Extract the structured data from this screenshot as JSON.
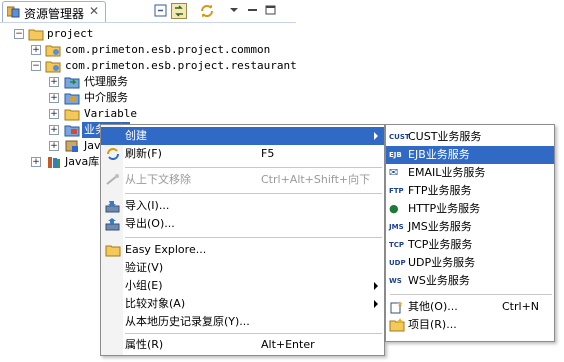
{
  "view": {
    "tab_title": "资源管理器",
    "tab_close": "✕"
  },
  "tree": {
    "items": [
      {
        "label": "project",
        "expander": "−"
      },
      {
        "label": "com.primeton.esb.project.common",
        "expander": "+"
      },
      {
        "label": "com.primeton.esb.project.restaurant",
        "expander": "−"
      },
      {
        "label": "代理服务",
        "expander": "+"
      },
      {
        "label": "中介服务",
        "expander": "+"
      },
      {
        "label": "Variable",
        "expander": "+"
      },
      {
        "label": "业务服务",
        "expander": "+"
      },
      {
        "label": "Java",
        "expander": "+"
      },
      {
        "label": "Java库",
        "expander": "+"
      }
    ]
  },
  "context_menu": {
    "items": [
      {
        "label": "创建",
        "shortcut": "",
        "submenu": true,
        "icon": "none"
      },
      {
        "label": "刷新(F)",
        "shortcut": "F5",
        "icon": "refresh-icon"
      },
      {
        "label": "从上下文移除",
        "shortcut": "Ctrl+Alt+Shift+向下",
        "disabled": true,
        "icon": "remove-context-icon"
      },
      {
        "label": "导入(I)...",
        "shortcut": "",
        "icon": "import-icon"
      },
      {
        "label": "导出(O)...",
        "shortcut": "",
        "icon": "export-icon"
      },
      {
        "label": "Easy Explore...",
        "shortcut": "",
        "icon": "folder-icon"
      },
      {
        "label": "验证(V)",
        "shortcut": ""
      },
      {
        "label": "小组(E)",
        "shortcut": "",
        "submenu": true
      },
      {
        "label": "比较对象(A)",
        "shortcut": "",
        "submenu": true
      },
      {
        "label": "从本地历史记录复原(Y)...",
        "shortcut": ""
      },
      {
        "label": "属性(R)",
        "shortcut": "Alt+Enter"
      }
    ]
  },
  "submenu": {
    "items": [
      {
        "label": "CUST业务服务",
        "icon_text": "CUST"
      },
      {
        "label": "EJB业务服务",
        "icon_text": "EJB",
        "selected": true
      },
      {
        "label": "EMAIL业务服务",
        "icon_text": "✉"
      },
      {
        "label": "FTP业务服务",
        "icon_text": "FTP"
      },
      {
        "label": "HTTP业务服务",
        "icon_text": "●"
      },
      {
        "label": "JMS业务服务",
        "icon_text": "JMS"
      },
      {
        "label": "TCP业务服务",
        "icon_text": "TCP"
      },
      {
        "label": "UDP业务服务",
        "icon_text": "UDP"
      },
      {
        "label": "WS业务服务",
        "icon_text": "WS"
      },
      {
        "label": "其他(O)...",
        "shortcut": "Ctrl+N"
      },
      {
        "label": "项目(R)..."
      }
    ]
  },
  "colors": {
    "selection": "#316ac5",
    "menu_border": "#8d8d8d"
  }
}
